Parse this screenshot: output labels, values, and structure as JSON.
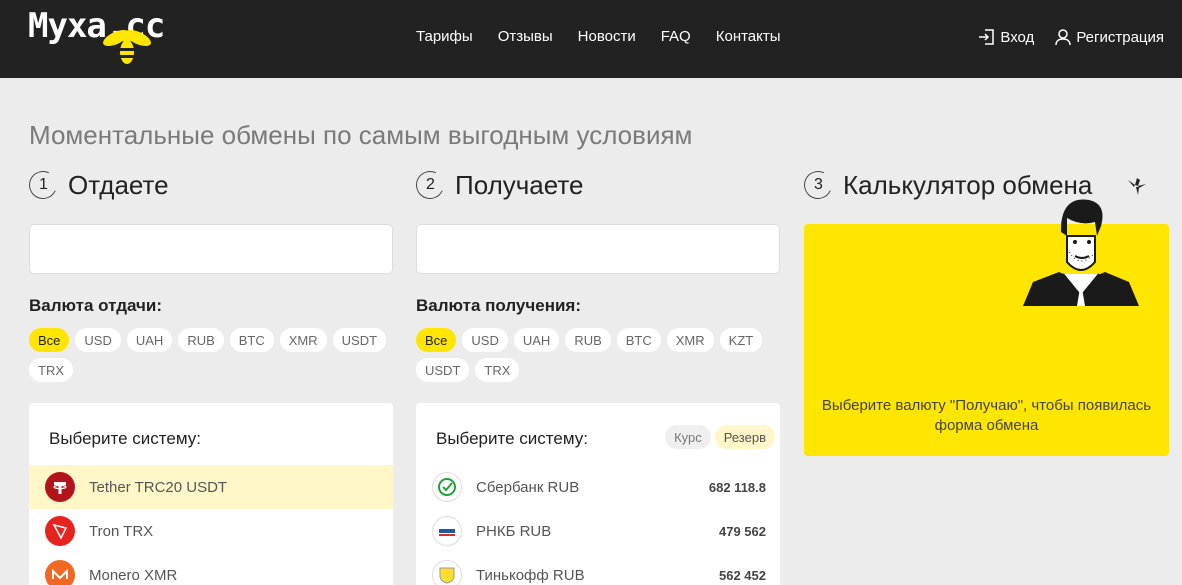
{
  "header": {
    "logo_text": "Myxa.cc",
    "nav": [
      "Тарифы",
      "Отзывы",
      "Новости",
      "FAQ",
      "Контакты"
    ],
    "login_label": "Вход",
    "register_label": "Регистрация"
  },
  "tagline": "Моментальные обмены по самым выгодным условиям",
  "give": {
    "step": "1",
    "title": "Отдаете",
    "search_placeholder": "",
    "currency_label": "Валюта отдачи:",
    "chips": [
      "Все",
      "USD",
      "UAH",
      "RUB",
      "BTC",
      "XMR",
      "USDT",
      "TRX"
    ],
    "active_chip": "Все",
    "panel_title": "Выберите систему:",
    "systems": [
      {
        "name": "Tether TRC20 USDT",
        "icon": "tether-icon",
        "selected": true
      },
      {
        "name": "Tron TRX",
        "icon": "tron-icon",
        "selected": false
      },
      {
        "name": "Monero XMR",
        "icon": "monero-icon",
        "selected": false
      }
    ]
  },
  "receive": {
    "step": "2",
    "title": "Получаете",
    "search_placeholder": "",
    "currency_label": "Валюта получения:",
    "chips": [
      "Все",
      "USD",
      "UAH",
      "RUB",
      "BTC",
      "XMR",
      "KZT",
      "USDT",
      "TRX"
    ],
    "active_chip": "Все",
    "panel_title": "Выберите систему:",
    "tabs": [
      "Курс",
      "Резерв"
    ],
    "active_tab": "Резерв",
    "systems": [
      {
        "name": "Сбербанк RUB",
        "icon": "sberbank-icon",
        "reserve": "682 118.8"
      },
      {
        "name": "РНКБ RUB",
        "icon": "rnkb-icon",
        "reserve": "479 562"
      },
      {
        "name": "Тинькофф RUB",
        "icon": "tinkoff-icon",
        "reserve": "562 452"
      }
    ]
  },
  "calculator": {
    "step": "3",
    "title": "Калькулятор обмена",
    "message": "Выберите валюту \"Получаю\", чтобы появилась форма обмена"
  },
  "colors": {
    "accent": "#ffe600",
    "header_bg": "#222222",
    "page_bg": "#ececec"
  }
}
